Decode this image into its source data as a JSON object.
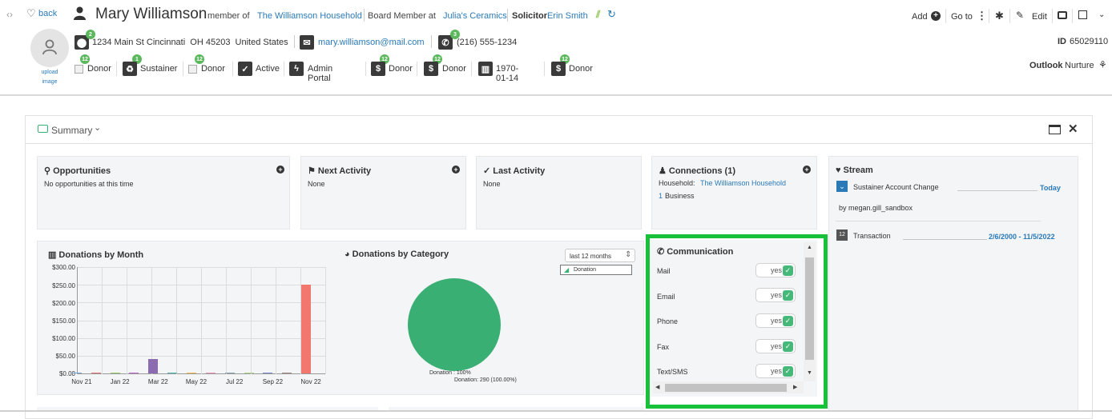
{
  "nav": {
    "arrows": "‹›",
    "back_label": "back"
  },
  "person": {
    "name": "Mary Williamson",
    "member_of_label": "member of",
    "household": "The Williamson Household",
    "role_label": "Board Member at",
    "org": "Julia's Ceramics",
    "solicitor_label": "Solicitor",
    "solicitor": "Erin Smith",
    "address": "1234 Main St Cincinnati  OH 45203  United States",
    "address_badge": "2",
    "email": "mary.williamson@mail.com",
    "phone": "(216) 555-1234",
    "phone_badge": "3",
    "upload_label": "upload image"
  },
  "tags": [
    {
      "label": "Donor",
      "badge": "12",
      "icon": "broken-image-icon"
    },
    {
      "label": "Sustainer",
      "badge": "1",
      "icon": "recycle-icon"
    },
    {
      "label": "Donor",
      "badge": "12",
      "icon": "broken-image-icon"
    },
    {
      "label": "Active",
      "badge": "",
      "icon": "check-icon"
    },
    {
      "label": "Admin Portal",
      "badge": "",
      "icon": "bolt-icon"
    },
    {
      "label": "Donor",
      "badge": "12",
      "icon": "dollar-icon"
    },
    {
      "label": "Donor",
      "badge": "12",
      "icon": "dollar-icon"
    },
    {
      "label": "1970-01-14",
      "badge": "",
      "icon": "cake-icon"
    },
    {
      "label": "Donor",
      "badge": "12",
      "icon": "dollar-icon"
    }
  ],
  "toolbar": {
    "add_label": "Add",
    "goto_label": "Go to",
    "edit_label": "Edit"
  },
  "record": {
    "id_label": "ID",
    "id_value": "65029110",
    "outlook_label": "Outlook",
    "outlook_value": "Nurture"
  },
  "summary": {
    "title": "Summary"
  },
  "opportunities": {
    "title": "Opportunities",
    "text": "No opportunities at this time"
  },
  "next_activity": {
    "title": "Next Activity",
    "text": "None"
  },
  "last_activity": {
    "title": "Last Activity",
    "text": "None"
  },
  "connections": {
    "title": "Connections (1)",
    "household_label": "Household:",
    "household": "The Williamson Household",
    "business_count": "1",
    "business_label": "Business"
  },
  "stream": {
    "title": "Stream",
    "item1_title": "Sustainer Account Change",
    "item1_date": "Today",
    "item1_by": "by megan.gill_sandbox",
    "item2_badge": "12",
    "item2_title": "Transaction",
    "item2_date": "2/6/2000 - 11/5/2022"
  },
  "communication": {
    "title": "Communication",
    "items": [
      {
        "label": "Mail",
        "value": "yes"
      },
      {
        "label": "Email",
        "value": "yes"
      },
      {
        "label": "Phone",
        "value": "yes"
      },
      {
        "label": "Fax",
        "value": "yes"
      },
      {
        "label": "Text/SMS",
        "value": "yes"
      }
    ]
  },
  "donations_by_category": {
    "title": "Donations by Category",
    "range": "last 12 months",
    "legend": "Donation",
    "pie_label": "Donation : 100%",
    "pie_value": "Donation: 290 (100.00%)",
    "color": "#3aaf74"
  },
  "chart_data": {
    "type": "bar",
    "title": "Donations by Month",
    "categories": [
      "Nov 21",
      "Dec 21",
      "Jan 22",
      "Feb 22",
      "Mar 22",
      "Apr 22",
      "May 22",
      "Jun 22",
      "Jul 22",
      "Aug 22",
      "Sep 22",
      "Oct 22",
      "Nov 22"
    ],
    "tick_labels": [
      "Nov 21",
      "",
      "Jan 22",
      "",
      "Mar 22",
      "",
      "May 22",
      "",
      "Jul 22",
      "",
      "Sep 22",
      "",
      "Nov 22"
    ],
    "values": [
      0,
      0,
      0,
      0,
      40,
      0,
      0,
      0,
      0,
      0,
      0,
      0,
      250
    ],
    "colors": [
      "#7aa9d6",
      "#e57373",
      "#9ccc65",
      "#ba68c8",
      "#8c6bb1",
      "#4db6ac",
      "#ffb74d",
      "#f48fb1",
      "#90a4ae",
      "#aed581",
      "#7986cb",
      "#a1887f",
      "#f2776f"
    ],
    "y_ticks": [
      "$0.00",
      "$50.00",
      "$100.00",
      "$150.00",
      "$200.00",
      "$250.00",
      "$300.00"
    ],
    "ylim": [
      0,
      300
    ],
    "grid": true
  }
}
